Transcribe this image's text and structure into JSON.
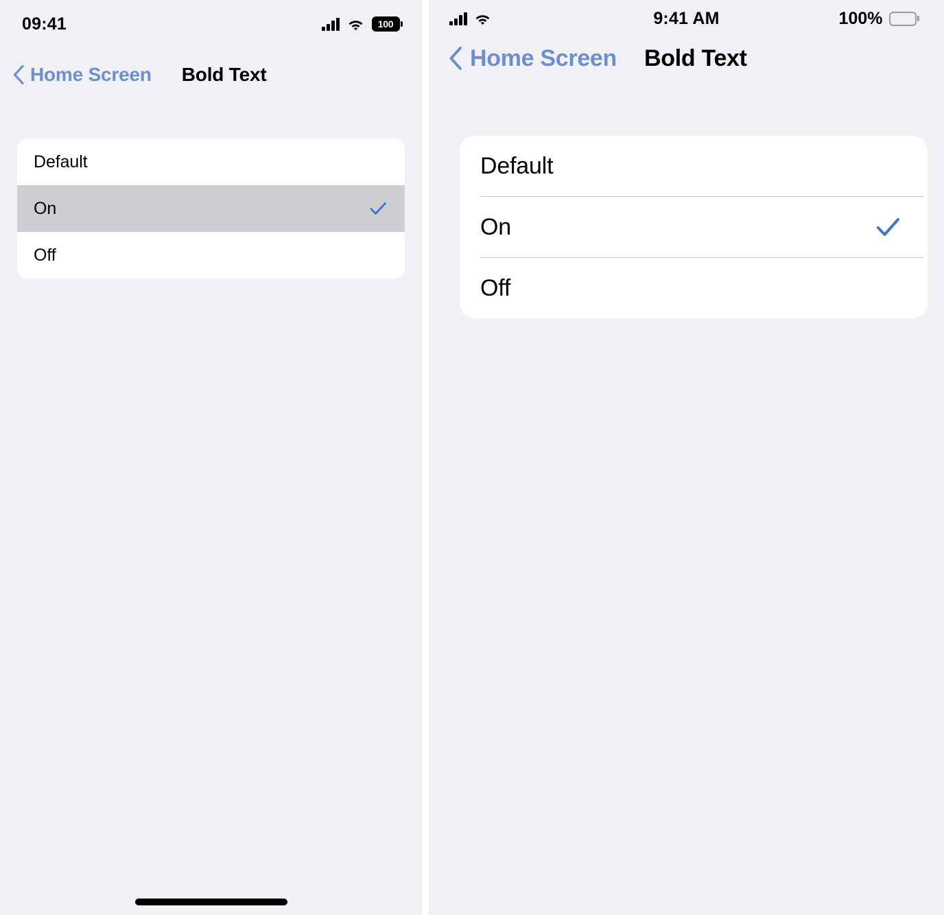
{
  "colors": {
    "page_background": "#f1f1f5",
    "card_background": "#ffffff",
    "accent_blue": "#3d76cc",
    "link_blue": "#6e8fcc",
    "selection_gray": "#ceced2",
    "separator": "#c9c9cc"
  },
  "panels": [
    {
      "id": "left-panel",
      "status_bar": {
        "time": "09:41",
        "signal_icon": "cellular-signal-icon",
        "wifi_icon": "wifi-icon",
        "battery_icon": "battery-icon",
        "battery_level_label": "100"
      },
      "nav_bar": {
        "back_icon": "chevron-left-icon",
        "back_label": "Home Screen",
        "title": "Bold Text"
      },
      "options": [
        {
          "label": "Default",
          "selected": false,
          "checked": false
        },
        {
          "label": "On",
          "selected": true,
          "checked": true
        },
        {
          "label": "Off",
          "selected": false,
          "checked": false
        }
      ],
      "has_separators": false,
      "has_home_indicator": true
    },
    {
      "id": "right-panel",
      "status_bar": {
        "time": "9:41 AM",
        "signal_icon": "cellular-signal-icon",
        "wifi_icon": "wifi-icon",
        "battery_icon": "battery-icon",
        "battery_percent_label": "100%"
      },
      "nav_bar": {
        "back_icon": "chevron-left-icon",
        "back_label": "Home Screen",
        "title": "Bold Text"
      },
      "options": [
        {
          "label": "Default",
          "selected": false,
          "checked": false
        },
        {
          "label": "On",
          "selected": false,
          "checked": true
        },
        {
          "label": "Off",
          "selected": false,
          "checked": false
        }
      ],
      "has_separators": true,
      "has_home_indicator": false
    }
  ]
}
